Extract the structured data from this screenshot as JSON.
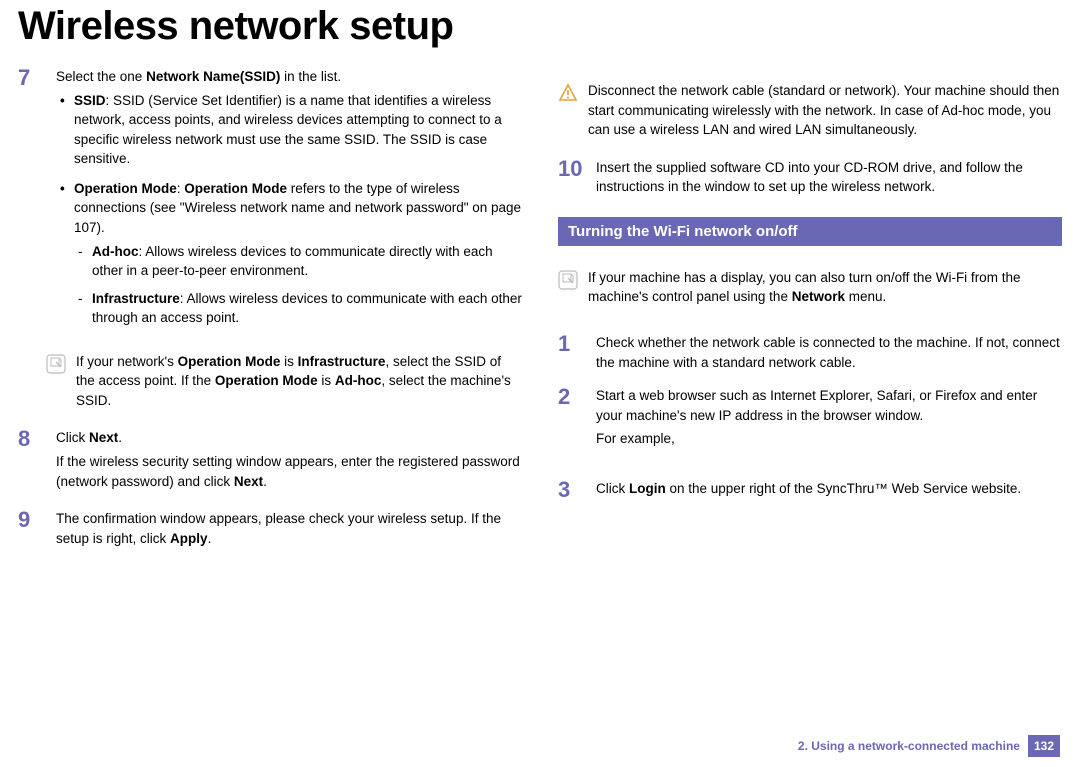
{
  "title": "Wireless network setup",
  "left": {
    "step7": {
      "num": "7",
      "intro_pre": "Select the one ",
      "intro_bold": "Network Name(SSID)",
      "intro_post": " in the list.",
      "ssid_label": "SSID",
      "ssid_text": ": SSID (Service Set Identifier) is a name that identifies a wireless network, access points, and wireless devices attempting to connect to a specific wireless network must use the same SSID. The SSID is case sensitive.",
      "opmode_label": "Operation Mode",
      "opmode_sep": ": ",
      "opmode_bold2": "Operation Mode",
      "opmode_text": " refers to the type of wireless connections (see \"Wireless network name and network password\" on page 107).",
      "adhoc_label": "Ad-hoc",
      "adhoc_text": ": Allows wireless devices to communicate directly with each other in a peer-to-peer environment.",
      "infra_label": "Infrastructure",
      "infra_text": ": Allows wireless devices to communicate with each other through an access point."
    },
    "note": {
      "p1_a": "If your network's ",
      "p1_b1": "Operation Mode",
      "p1_b": " is ",
      "p1_b2": "Infrastructure",
      "p1_c": ", select the SSID of the access point. If the ",
      "p1_b3": "Operation Mode",
      "p1_d": " is ",
      "p1_b4": "Ad-hoc",
      "p1_e": ", select the machine's SSID."
    },
    "step8": {
      "num": "8",
      "line1_a": "Click ",
      "line1_b": "Next",
      "line1_c": ".",
      "line2_a": "If the wireless security setting window appears, enter the registered password (network password) and click ",
      "line2_b": "Next",
      "line2_c": "."
    },
    "step9": {
      "num": "9",
      "text_a": "The confirmation window appears, please check your wireless setup. If the setup is right, click ",
      "text_b": "Apply",
      "text_c": "."
    }
  },
  "right": {
    "warn": {
      "text": "Disconnect the network cable (standard or network). Your machine should then start communicating wirelessly with the network. In case of Ad-hoc mode, you can use a wireless LAN and wired LAN simultaneously."
    },
    "step10": {
      "num": "10",
      "text": "Insert the supplied software CD into your CD-ROM drive, and follow the instructions in the window to set up the wireless network."
    },
    "section_title": "Turning the Wi-Fi network on/off",
    "tip": {
      "text_a": "If your machine has a display, you can also turn on/off the Wi-Fi from the machine's control panel using the ",
      "text_b": "Network",
      "text_c": " menu."
    },
    "step1": {
      "num": "1",
      "text": "Check whether the network cable is connected to the machine. If not, connect the machine with a standard network cable."
    },
    "step2": {
      "num": "2",
      "line1": "Start a web browser such as Internet Explorer, Safari, or Firefox and enter your machine's new IP address in the browser window.",
      "line2": "For example,"
    },
    "step3": {
      "num": "3",
      "text_a": "Click ",
      "text_b": "Login",
      "text_c": " on the upper right of the SyncThru™ Web Service website."
    }
  },
  "footer": {
    "chapter": "2.  Using a network-connected machine",
    "page": "132"
  }
}
